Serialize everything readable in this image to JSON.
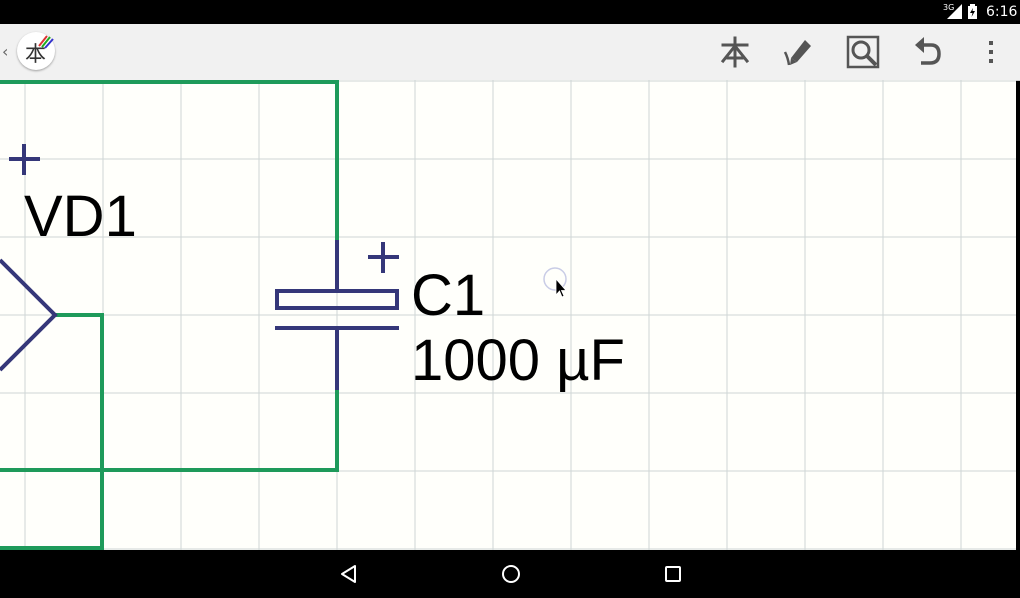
{
  "status_bar": {
    "network": "3G",
    "time": "6:16",
    "icons": [
      "signal-icon",
      "battery-icon"
    ]
  },
  "action_bar": {
    "logo_glyph": "本",
    "actions": [
      {
        "name": "component-library-button",
        "icon": "component-icon"
      },
      {
        "name": "draw-mode-button",
        "icon": "pencil-icon"
      },
      {
        "name": "zoom-button",
        "icon": "magnifier-icon"
      },
      {
        "name": "undo-button",
        "icon": "undo-icon"
      },
      {
        "name": "overflow-menu-button",
        "icon": "more-vert-icon"
      }
    ]
  },
  "schematic": {
    "components": [
      {
        "ref": "VD1",
        "type": "diode",
        "polarity": "+"
      },
      {
        "ref": "C1",
        "type": "polarized-capacitor",
        "value": "1000 µF",
        "polarity": "+"
      }
    ],
    "colors": {
      "wire": "#1e9a5a",
      "component": "#353779",
      "grid": "#cfd6d6",
      "background": "#fffffb"
    }
  },
  "nav_bar": {
    "buttons": [
      "back",
      "home",
      "recents"
    ]
  }
}
